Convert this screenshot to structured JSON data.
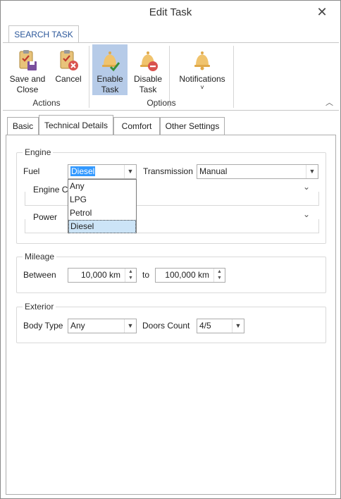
{
  "window": {
    "title": "Edit Task"
  },
  "ribbon": {
    "tab_label": "SEARCH TASK",
    "save_close": "Save and Close",
    "save_close_l1": "Save and",
    "save_close_l2": "Close",
    "cancel": "Cancel",
    "actions_group": "Actions",
    "enable_l1": "Enable",
    "enable_l2": "Task",
    "disable_l1": "Disable",
    "disable_l2": "Task",
    "notifications": "Notifications",
    "notifications_arrow": "˅",
    "options_group": "Options"
  },
  "tabs": [
    {
      "label": "Basic"
    },
    {
      "label": "Technical Details"
    },
    {
      "label": "Comfort"
    },
    {
      "label": "Other Settings"
    }
  ],
  "engine": {
    "legend": "Engine",
    "fuel_label": "Fuel",
    "fuel_value": "Diesel",
    "fuel_options": [
      "Any",
      "LPG",
      "Petrol",
      "Diesel"
    ],
    "transmission_label": "Transmission",
    "transmission_value": "Manual",
    "capacity_label": "Engine Ca",
    "power_label": "Power"
  },
  "mileage": {
    "legend": "Mileage",
    "between_label": "Between",
    "from_value": "10,000 km",
    "to_label": "to",
    "to_value": "100,000 km"
  },
  "exterior": {
    "legend": "Exterior",
    "body_type_label": "Body Type",
    "body_type_value": "Any",
    "doors_label": "Doors Count",
    "doors_value": "4/5"
  },
  "colors": {
    "accent": "#2b579a",
    "active_button": "#b6cbe8",
    "selection": "#3399ff"
  }
}
